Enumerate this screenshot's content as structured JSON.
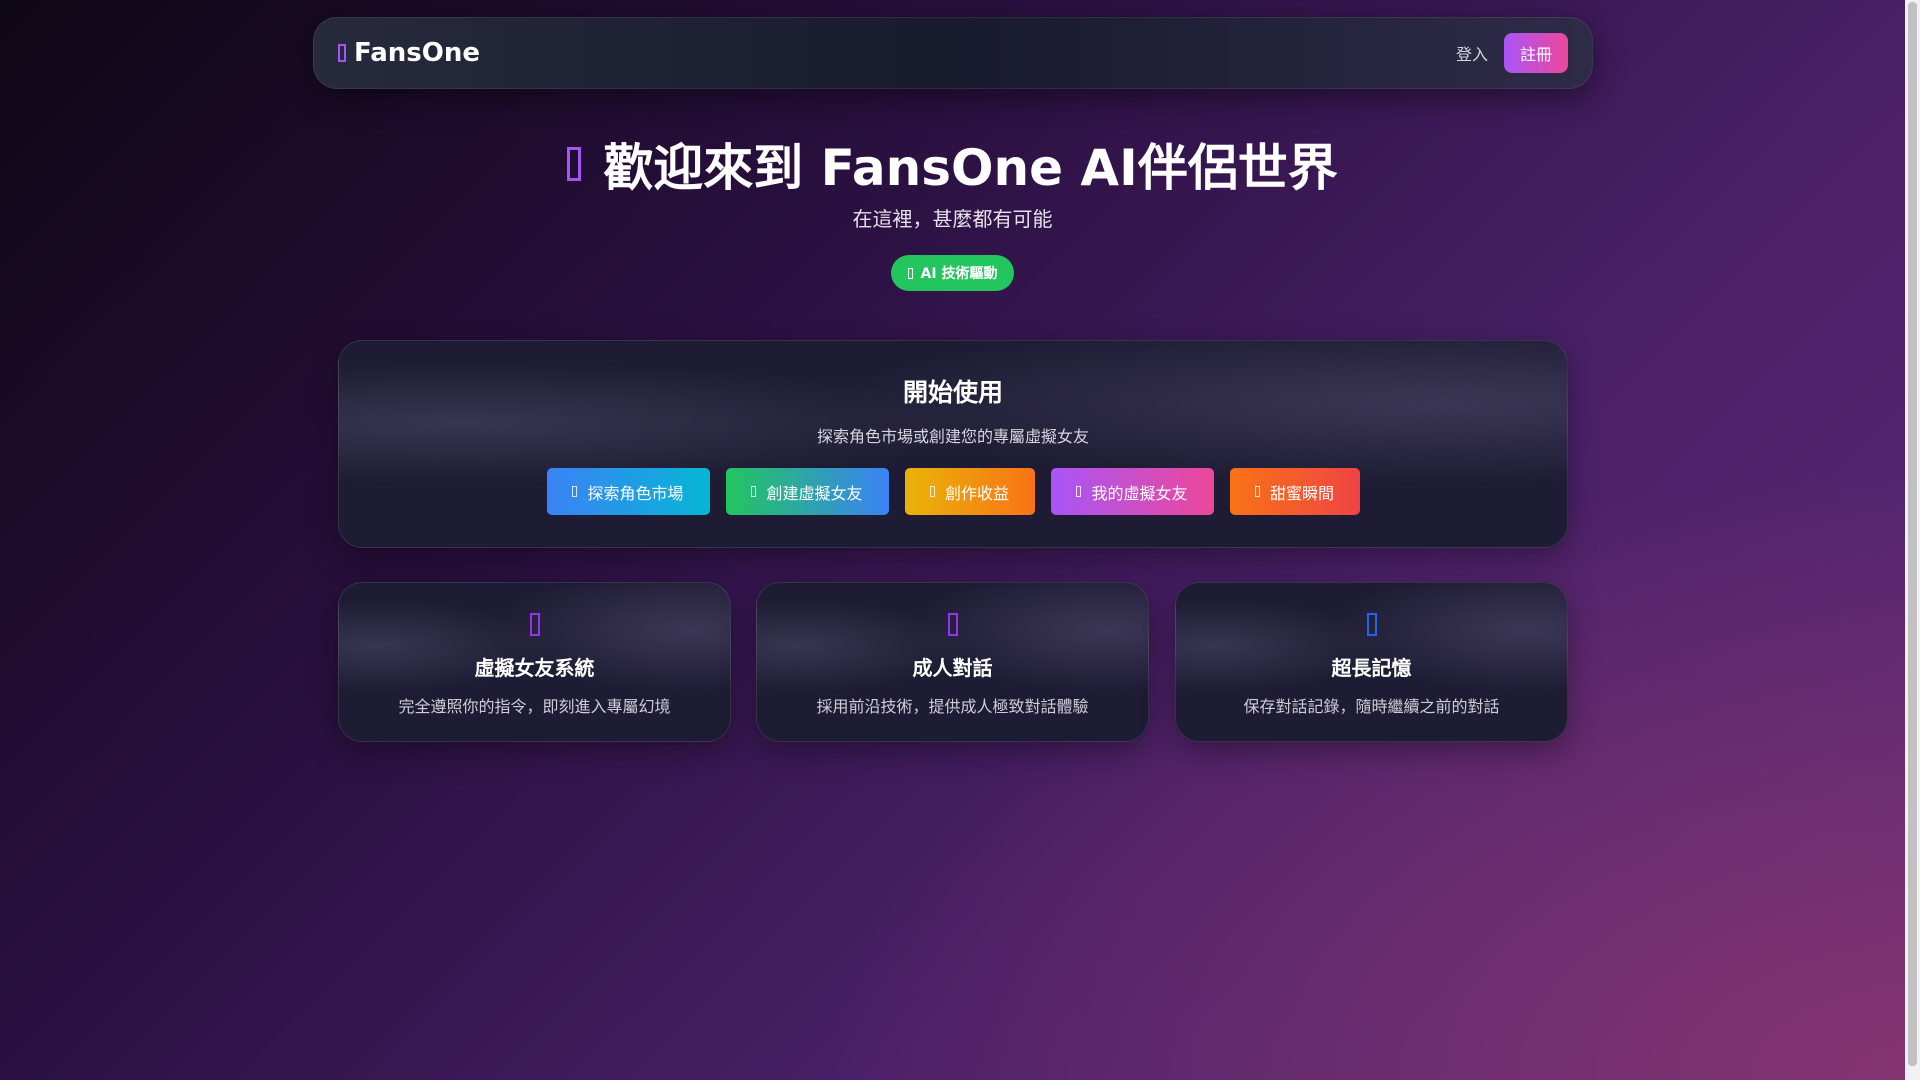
{
  "nav": {
    "logo": "FansOne",
    "login": "登入",
    "register": "註冊"
  },
  "hero": {
    "title": "歡迎來到 FansOne AI伴侶世界",
    "subtitle": "在這裡，甚麼都有可能",
    "badge": "AI 技術驅動"
  },
  "start": {
    "title": "開始使用",
    "subtitle": "探索角色市場或創建您的專屬虛擬女友",
    "buttons": [
      {
        "label": "探索角色市場",
        "gradient": [
          "#3b82f6",
          "#06b6d4"
        ]
      },
      {
        "label": "創建虛擬女友",
        "gradient": [
          "#22c55e",
          "#3b82f6"
        ]
      },
      {
        "label": "創作收益",
        "gradient": [
          "#eab308",
          "#f97316"
        ]
      },
      {
        "label": "我的虛擬女友",
        "gradient": [
          "#a855f7",
          "#ec4899"
        ]
      },
      {
        "label": "甜蜜瞬間",
        "gradient": [
          "#f97316",
          "#ef4444"
        ]
      }
    ]
  },
  "features": [
    {
      "title": "虛擬女友系統",
      "desc": "完全遵照你的指令，即刻進入專屬幻境",
      "icon_color": "#9333ea"
    },
    {
      "title": "成人對話",
      "desc": "採用前沿技術，提供成人極致對話體驗",
      "icon_color": "#9333ea"
    },
    {
      "title": "超長記憶",
      "desc": "保存對話記錄，隨時繼續之前的對話",
      "icon_color": "#2563eb"
    }
  ]
}
